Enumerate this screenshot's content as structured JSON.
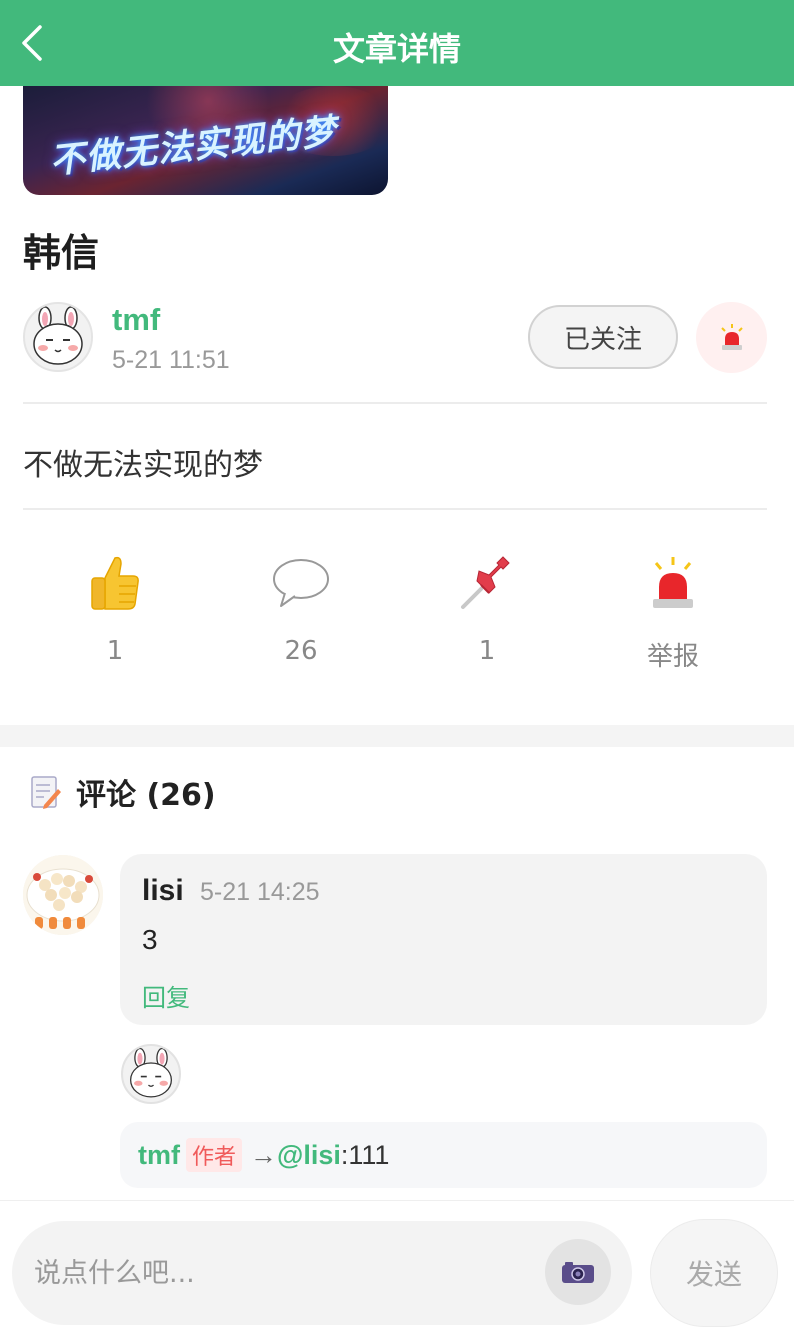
{
  "header": {
    "title": "文章详情",
    "back_icon": "chevron-left-icon"
  },
  "cover": {
    "overlay_text": "不做无法实现的梦"
  },
  "article": {
    "title": "韩信",
    "body": "不做无法实现的梦",
    "author": {
      "name": "tmf",
      "time": "5-21 11:51"
    },
    "follow_label": "已关注"
  },
  "actions": {
    "like": {
      "count": "1",
      "icon": "thumbs-up-icon"
    },
    "comment": {
      "count": "26",
      "icon": "speech-bubble-icon"
    },
    "pin": {
      "count": "1",
      "icon": "pushpin-icon"
    },
    "report": {
      "label": "举报",
      "icon": "siren-icon"
    }
  },
  "comments": {
    "title": "评论 (26)",
    "items": [
      {
        "user": "lisi",
        "time": "5-21 14:25",
        "text": "3",
        "reply_label": "回复",
        "replies": [
          {
            "user": "tmf",
            "badge": "作者",
            "arrow": "→",
            "target": "@lisi",
            "colon": ":",
            "text": "111"
          }
        ]
      }
    ]
  },
  "composer": {
    "placeholder": "说点什么吧...",
    "send_label": "发送",
    "camera_icon": "camera-icon"
  },
  "colors": {
    "brand": "#42b97c",
    "danger": "#f05a5a"
  }
}
